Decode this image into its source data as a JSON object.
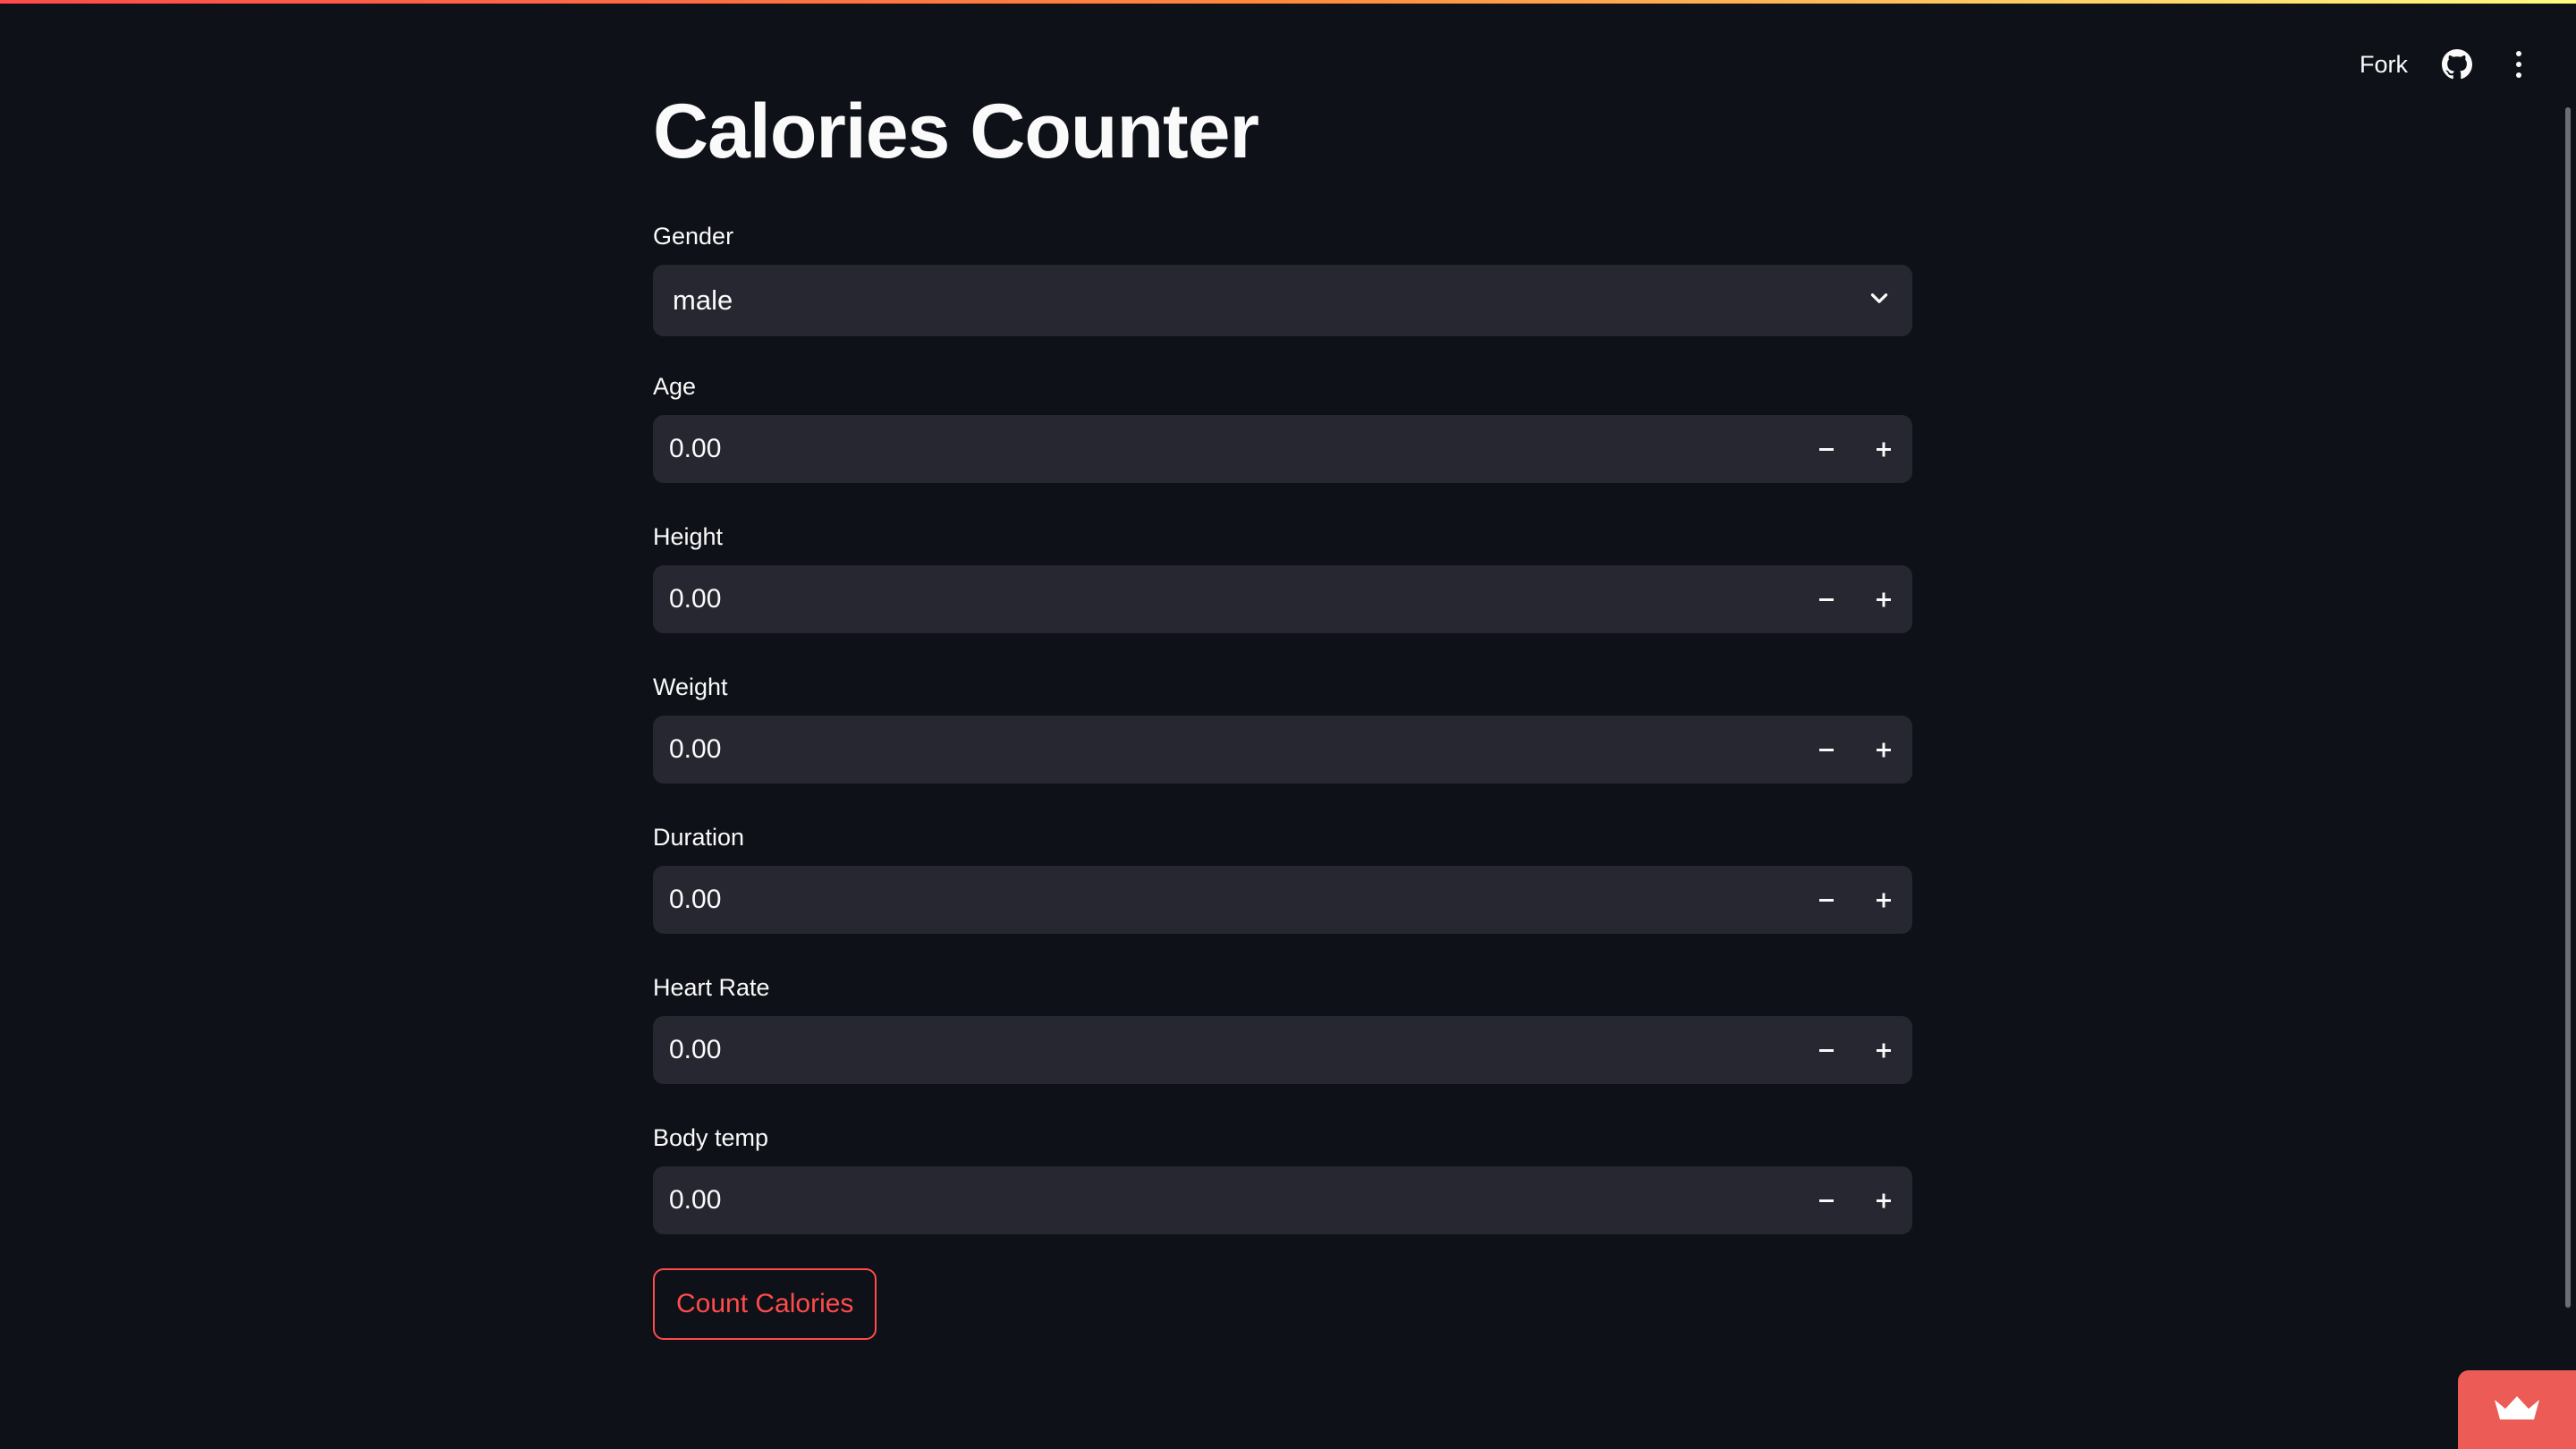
{
  "header": {
    "fork_label": "Fork",
    "icons": [
      "github-icon",
      "more-vertical-icon"
    ]
  },
  "page": {
    "title": "Calories Counter"
  },
  "form": {
    "gender": {
      "label": "Gender",
      "value": "male"
    },
    "fields": [
      {
        "label": "Age",
        "value": "0.00"
      },
      {
        "label": "Height",
        "value": "0.00"
      },
      {
        "label": "Weight",
        "value": "0.00"
      },
      {
        "label": "Duration",
        "value": "0.00"
      },
      {
        "label": "Heart Rate",
        "value": "0.00"
      },
      {
        "label": "Body temp",
        "value": "0.00"
      }
    ],
    "submit_label": "Count Calories"
  },
  "colors": {
    "background": "#0e1117",
    "input_bg": "#262730",
    "accent": "#ff4b4b",
    "badge": "#ec5b55"
  }
}
